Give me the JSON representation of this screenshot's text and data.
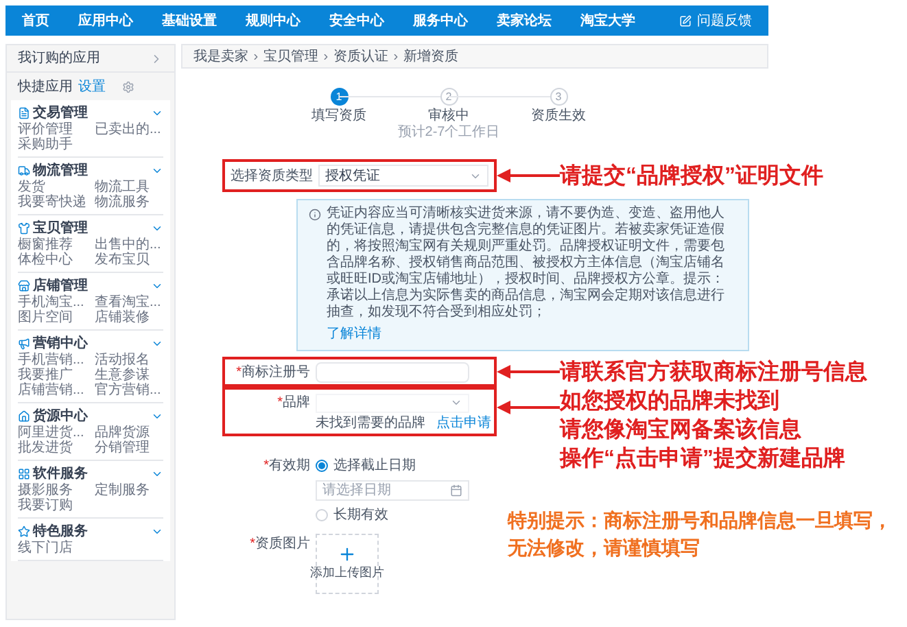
{
  "nav": {
    "items": [
      "首页",
      "应用中心",
      "基础设置",
      "规则中心",
      "安全中心",
      "服务中心",
      "卖家论坛",
      "淘宝大学"
    ],
    "feedback": "问题反馈"
  },
  "sidebar": {
    "subscribed": "我订购的应用",
    "quick": {
      "label": "快捷应用",
      "setting": "设置"
    },
    "sections": [
      {
        "title": "交易管理",
        "items": [
          "评价管理",
          "已卖出的...",
          "采购助手"
        ]
      },
      {
        "title": "物流管理",
        "items": [
          "发货",
          "物流工具",
          "我要寄快递",
          "物流服务"
        ]
      },
      {
        "title": "宝贝管理",
        "items": [
          "橱窗推荐",
          "出售中的...",
          "体检中心",
          "发布宝贝"
        ]
      },
      {
        "title": "店铺管理",
        "items": [
          "手机淘宝...",
          "查看淘宝...",
          "图片空间",
          "店铺装修"
        ]
      },
      {
        "title": "营销中心",
        "items": [
          "手机营销...",
          "活动报名",
          "我要推广",
          "生意参谋",
          "店铺营销...",
          "官方营销..."
        ]
      },
      {
        "title": "货源中心",
        "items": [
          "阿里进货...",
          "品牌货源",
          "批发进货",
          "分销管理"
        ]
      },
      {
        "title": "软件服务",
        "items": [
          "摄影服务",
          "定制服务",
          "我要订购"
        ]
      },
      {
        "title": "特色服务",
        "items": [
          "线下门店"
        ]
      }
    ]
  },
  "breadcrumb": [
    "我是卖家",
    "宝贝管理",
    "资质认证",
    "新增资质"
  ],
  "steps": [
    {
      "number": "1",
      "label": "填写资质",
      "selected": true
    },
    {
      "number": "2",
      "label": "审核中",
      "note": "预计2-7个工作日",
      "selected": false
    },
    {
      "number": "3",
      "label": "资质生效",
      "selected": false
    }
  ],
  "form": {
    "type_select": {
      "label": "选择资质类型",
      "value": "授权凭证"
    },
    "notice": {
      "text": "凭证内容应当可清晰核实进货来源，请不要伪造、变造、盗用他人的凭证信息，请提供包含完整信息的凭证图片。若被卖家凭证造假的，将按照淘宝网有关规则严重处罚。品牌授权证明文件，需要包含品牌名称、授权销售商品范围、被授权方主体信息（淘宝店铺名或旺旺ID或淘宝店铺地址），授权时间、品牌授权方公章。提示：承诺以上信息为实际售卖的商品信息，淘宝网会定期对该信息进行抽查，如发现不符合受到相应处罚；",
      "link": "了解详情"
    },
    "trademark": {
      "mark": "*",
      "label": "商标注册号"
    },
    "brand": {
      "mark": "*",
      "label": "品牌",
      "hint": "未找到需要的品牌",
      "link": "点击申请"
    },
    "validity": {
      "mark": "*",
      "label": "有效期",
      "options": [
        {
          "label": "选择截止日期",
          "selected": true
        },
        {
          "label": "长期有效",
          "selected": false
        }
      ],
      "date_placeholder": "请选择日期"
    },
    "image": {
      "mark": "*",
      "label": "资质图片",
      "upload": "添加上传图片"
    }
  },
  "annotations": [
    {
      "lines": [
        "请提交“品牌授权”证明文件"
      ]
    },
    {
      "lines": [
        "请联系官方获取商标注册号信息"
      ]
    },
    {
      "lines": [
        "如您授权的品牌未找到",
        "请您像淘宝网备案该信息",
        "操作“点击申请”提交新建品牌"
      ]
    },
    {
      "lines": [
        "特别提示：商标注册号和品牌信息一旦填写，",
        "无法修改，请谨慎填写"
      ]
    }
  ]
}
